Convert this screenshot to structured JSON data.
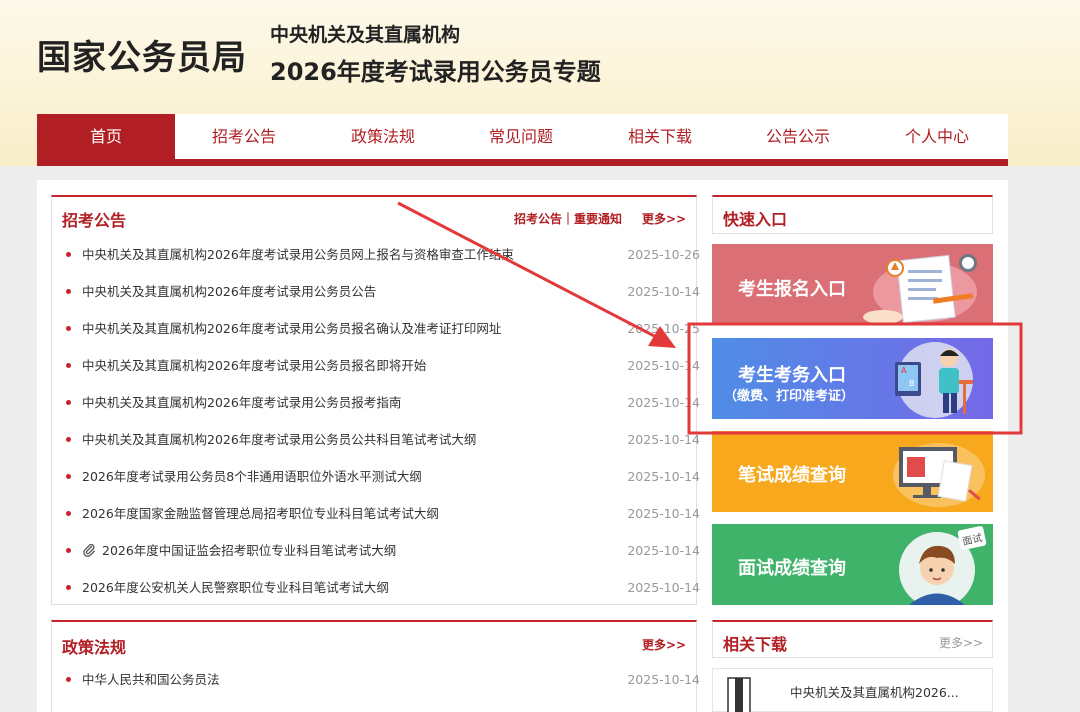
{
  "header": {
    "logo": "国家公务员局",
    "subtitle1": "中央机关及其直属机构",
    "subtitle2": "2026年度考试录用公务员专题"
  },
  "nav": [
    {
      "label": "首页",
      "active": true
    },
    {
      "label": "招考公告"
    },
    {
      "label": "政策法规"
    },
    {
      "label": "常见问题"
    },
    {
      "label": "相关下载"
    },
    {
      "label": "公告公示"
    },
    {
      "label": "个人中心"
    }
  ],
  "announcements": {
    "title": "招考公告",
    "links": "招考公告｜重要通知",
    "more": "更多>>",
    "items": [
      {
        "text": "中央机关及其直属机构2026年度考试录用公务员网上报名与资格审查工作结束",
        "date": "2025-10-26"
      },
      {
        "text": "中央机关及其直属机构2026年度考试录用公务员公告",
        "date": "2025-10-14"
      },
      {
        "text": "中央机关及其直属机构2026年度考试录用公务员报名确认及准考证打印网址",
        "date": "2025-10-25"
      },
      {
        "text": "中央机关及其直属机构2026年度考试录用公务员报名即将开始",
        "date": "2025-10-14"
      },
      {
        "text": "中央机关及其直属机构2026年度考试录用公务员报考指南",
        "date": "2025-10-14"
      },
      {
        "text": "中央机关及其直属机构2026年度考试录用公务员公共科目笔试考试大纲",
        "date": "2025-10-14"
      },
      {
        "text": "2026年度考试录用公务员8个非通用语职位外语水平测试大纲",
        "date": "2025-10-14"
      },
      {
        "text": "2026年度国家金融监督管理总局招考职位专业科目笔试考试大纲",
        "date": "2025-10-14"
      },
      {
        "text": "2026年度中国证监会招考职位专业科目笔试考试大纲",
        "date": "2025-10-14",
        "attachment": true
      },
      {
        "text": "2026年度公安机关人民警察职位专业科目笔试考试大纲",
        "date": "2025-10-14"
      }
    ]
  },
  "quick": {
    "title": "快速入口",
    "entries": [
      {
        "label": "考生报名入口",
        "color": "#db6f76"
      },
      {
        "label": "考生考务入口",
        "sublabel": "（缴费、打印准考证）",
        "color": "#5a7de8"
      },
      {
        "label": "笔试成绩查询",
        "color": "#f5a623"
      },
      {
        "label": "面试成绩查询",
        "color": "#3fb36a",
        "badge": "面试"
      }
    ]
  },
  "policy": {
    "title": "政策法规",
    "more": "更多>>",
    "items": [
      {
        "text": "中华人民共和国公务员法",
        "date": "2025-10-14"
      }
    ]
  },
  "downloads": {
    "title": "相关下载",
    "more": "更多>>",
    "items": [
      {
        "text": "中央机关及其直属机构2026..."
      }
    ]
  },
  "colors": {
    "brand_red": "#b11f24",
    "highlight_red": "#e23a3a"
  }
}
